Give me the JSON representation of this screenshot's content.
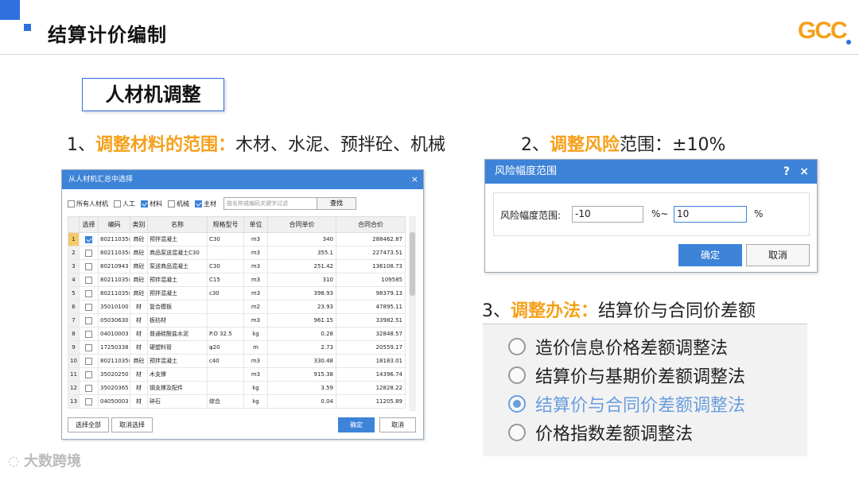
{
  "header": {
    "title": "结算计价编制",
    "logo": "GCC"
  },
  "section": {
    "title": "人材机调整"
  },
  "point1": {
    "num": "1、",
    "hl": "调整材料的范围：",
    "text": "木材、水泥、预拌砼、机械"
  },
  "point2": {
    "num": "2、",
    "hl": "调整风险",
    "text": "范围：±10%"
  },
  "point3": {
    "num": "3、",
    "hl": "调整办法：",
    "text": "结算价与合同价差额"
  },
  "material_dialog": {
    "title": "从人材机汇总中选择",
    "close": "×",
    "filters": [
      {
        "label": "所有人材机",
        "checked": false
      },
      {
        "label": "人工",
        "checked": false
      },
      {
        "label": "材料",
        "checked": true
      },
      {
        "label": "机械",
        "checked": false
      },
      {
        "label": "主材",
        "checked": true
      }
    ],
    "filter_placeholder": "按名称或编码关键字过滤",
    "find_label": "查找",
    "columns": [
      "选择",
      "编码",
      "类别",
      "名称",
      "规格型号",
      "单位",
      "合同单价",
      "合同合价"
    ],
    "rows": [
      {
        "n": "1",
        "checked": true,
        "code": "80211035@5",
        "cat": "商砼",
        "name": "预拌混凝土",
        "spec": "C30",
        "unit": "m3",
        "price": "340",
        "total": "288462.87"
      },
      {
        "n": "2",
        "checked": false,
        "code": "80211035@6",
        "cat": "商砼",
        "name": "商品泵送混凝土C30",
        "spec": "",
        "unit": "m3",
        "price": "355.1",
        "total": "227473.51"
      },
      {
        "n": "3",
        "checked": false,
        "code": "80210943",
        "cat": "商砼",
        "name": "泵送商品混凝土",
        "spec": "C30",
        "unit": "m3",
        "price": "251.42",
        "total": "136108.73"
      },
      {
        "n": "4",
        "checked": false,
        "code": "80211035@1",
        "cat": "商砼",
        "name": "预拌混凝土",
        "spec": "C15",
        "unit": "m3",
        "price": "310",
        "total": "109585"
      },
      {
        "n": "5",
        "checked": false,
        "code": "80211035@7",
        "cat": "商砼",
        "name": "预拌混凝土",
        "spec": "c30",
        "unit": "m3",
        "price": "398.93",
        "total": "98379.13"
      },
      {
        "n": "6",
        "checked": false,
        "code": "35010100",
        "cat": "材",
        "name": "复合模板",
        "spec": "",
        "unit": "m2",
        "price": "23.93",
        "total": "47895.11"
      },
      {
        "n": "7",
        "checked": false,
        "code": "05030630",
        "cat": "材",
        "name": "板枋材",
        "spec": "",
        "unit": "m3",
        "price": "961.15",
        "total": "33982.51"
      },
      {
        "n": "8",
        "checked": false,
        "code": "04010003",
        "cat": "材",
        "name": "普通硅酸盐水泥",
        "spec": "P.O 32.5",
        "unit": "kg",
        "price": "0.28",
        "total": "32848.57"
      },
      {
        "n": "9",
        "checked": false,
        "code": "17250338",
        "cat": "材",
        "name": "硬塑料管",
        "spec": "φ20",
        "unit": "m",
        "price": "2.73",
        "total": "20559.17"
      },
      {
        "n": "10",
        "checked": false,
        "code": "80211035@8",
        "cat": "商砼",
        "name": "预拌混凝土",
        "spec": "c40",
        "unit": "m3",
        "price": "330.48",
        "total": "18183.01"
      },
      {
        "n": "11",
        "checked": false,
        "code": "35020250",
        "cat": "材",
        "name": "木支撑",
        "spec": "",
        "unit": "m3",
        "price": "915.38",
        "total": "14396.74"
      },
      {
        "n": "12",
        "checked": false,
        "code": "35020365",
        "cat": "材",
        "name": "钢支撑及配件",
        "spec": "",
        "unit": "kg",
        "price": "3.59",
        "total": "12828.22"
      },
      {
        "n": "13",
        "checked": false,
        "code": "04050003",
        "cat": "材",
        "name": "碎石",
        "spec": "综合",
        "unit": "kg",
        "price": "0.04",
        "total": "11205.89"
      }
    ],
    "select_all": "选择全部",
    "cancel_select": "取消选择",
    "ok": "确定",
    "cancel": "取消"
  },
  "risk_dialog": {
    "title": "风险幅度范围",
    "help": "?",
    "close": "×",
    "label": "风险幅度范围:",
    "min": "-10",
    "mid": "%~",
    "max": "10",
    "unit": "%",
    "ok": "确定",
    "cancel": "取消"
  },
  "methods": {
    "options": [
      {
        "label": "造价信息价格差额调整法",
        "selected": false
      },
      {
        "label": "结算价与基期价差额调整法",
        "selected": false
      },
      {
        "label": "结算价与合同价差额调整法",
        "selected": true
      },
      {
        "label": "价格指数差额调整法",
        "selected": false
      }
    ]
  },
  "watermark": {
    "text": "大数跨境"
  },
  "colors": {
    "accent": "#2f6fde",
    "highlight": "#f5a01a",
    "dialog_title": "#3d83d8"
  }
}
